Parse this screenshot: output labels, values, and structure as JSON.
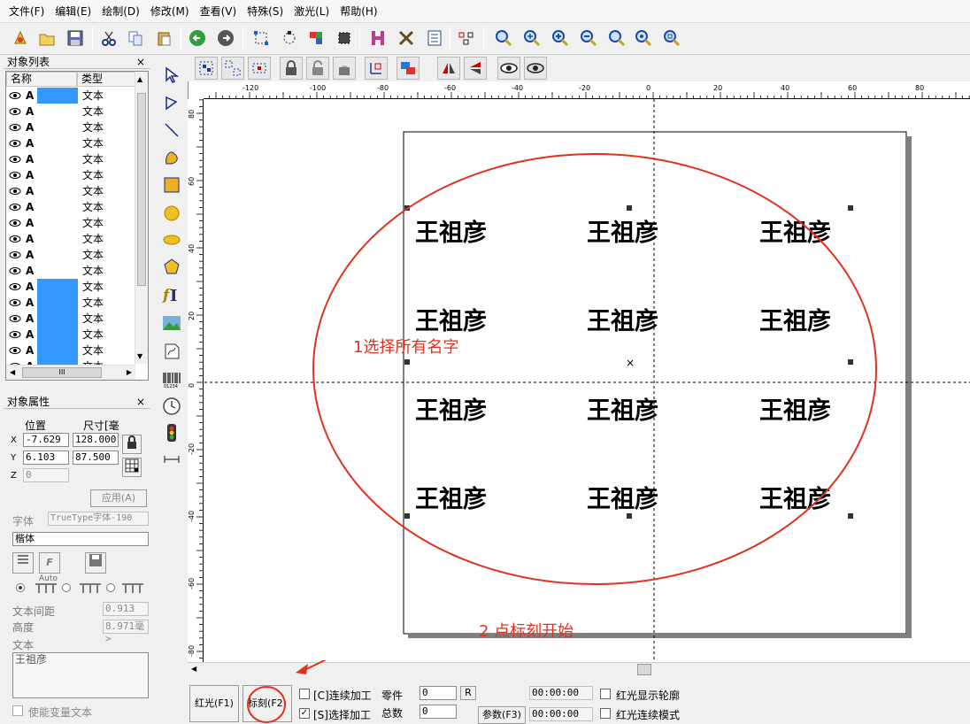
{
  "menu": [
    "文件(F)",
    "编辑(E)",
    "绘制(D)",
    "修改(M)",
    "查看(V)",
    "特殊(S)",
    "激光(L)",
    "帮助(H)"
  ],
  "object_list": {
    "title": "对象列表",
    "close": "×",
    "col_name": "名称",
    "col_type": "类型",
    "rows": [
      {
        "name": "A",
        "type": "文本",
        "selected": true
      },
      {
        "name": "A",
        "type": "文本",
        "selected": false
      },
      {
        "name": "A",
        "type": "文本",
        "selected": false
      },
      {
        "name": "A",
        "type": "文本",
        "selected": false
      },
      {
        "name": "A",
        "type": "文本",
        "selected": false
      },
      {
        "name": "A",
        "type": "文本",
        "selected": false
      },
      {
        "name": "A",
        "type": "文本",
        "selected": false
      },
      {
        "name": "A",
        "type": "文本",
        "selected": false
      },
      {
        "name": "A",
        "type": "文本",
        "selected": false
      },
      {
        "name": "A",
        "type": "文本",
        "selected": false
      },
      {
        "name": "A",
        "type": "文本",
        "selected": false
      },
      {
        "name": "A",
        "type": "文本",
        "selected": false
      },
      {
        "name": "A",
        "type": "文本",
        "selected": true
      },
      {
        "name": "A",
        "type": "文本",
        "selected": true
      },
      {
        "name": "A",
        "type": "文本",
        "selected": true
      },
      {
        "name": "A",
        "type": "文本",
        "selected": true
      },
      {
        "name": "A",
        "type": "文本",
        "selected": true
      },
      {
        "name": "A",
        "type": "文本",
        "selected": true
      }
    ],
    "scroll_mark": "III"
  },
  "props": {
    "title": "对象属性",
    "close": "×",
    "pos_label": "位置",
    "size_label": "尺寸[毫",
    "x_label": "X",
    "y_label": "Y",
    "z_label": "Z",
    "x_pos": "-7.629",
    "x_size": "128.000",
    "y_pos": "6.103",
    "y_size": "87.500",
    "z_val": "0",
    "apply": "应用(A)",
    "font_label": "字体",
    "font_value": "TrueType字体-190",
    "face_value": "楷体",
    "auto": "Auto",
    "spacing_label": "文本间距",
    "spacing_value": "0.913",
    "height_label": "高度",
    "height_value": "8.971毫>",
    "text_label": "文本",
    "text_value": "王祖彦",
    "variable_text": "使能变量文本"
  },
  "ruler_h": [
    "-120",
    "-100",
    "-80",
    "-60",
    "-40",
    "-20",
    "0",
    "20",
    "40",
    "60",
    "80"
  ],
  "ruler_v": [
    "80",
    "60",
    "40",
    "20",
    "0",
    "-20",
    "-40",
    "-60",
    "-80"
  ],
  "canvas": {
    "item_text": "王祖彦",
    "annotation1": "1选择所有名字",
    "annotation2": "2 点标刻开始",
    "center_mark": "×"
  },
  "bottom": {
    "red_btn": "红光(F1)",
    "mark_btn": "标刻(F2)",
    "continuous": "[C]连续加工",
    "select_proc": "[S]选择加工",
    "parts_label": "零件",
    "parts_value": "0",
    "r_btn": "R",
    "total_label": "总数",
    "total_value": "0",
    "params_btn": "参数(F3)",
    "time1": "00:00:00",
    "time2": "00:00:00",
    "red_outline": "红光显示轮廓",
    "red_continuous": "红光连续模式"
  },
  "colors": {
    "annotation": "#e0321e",
    "selection": "#3399ff"
  }
}
